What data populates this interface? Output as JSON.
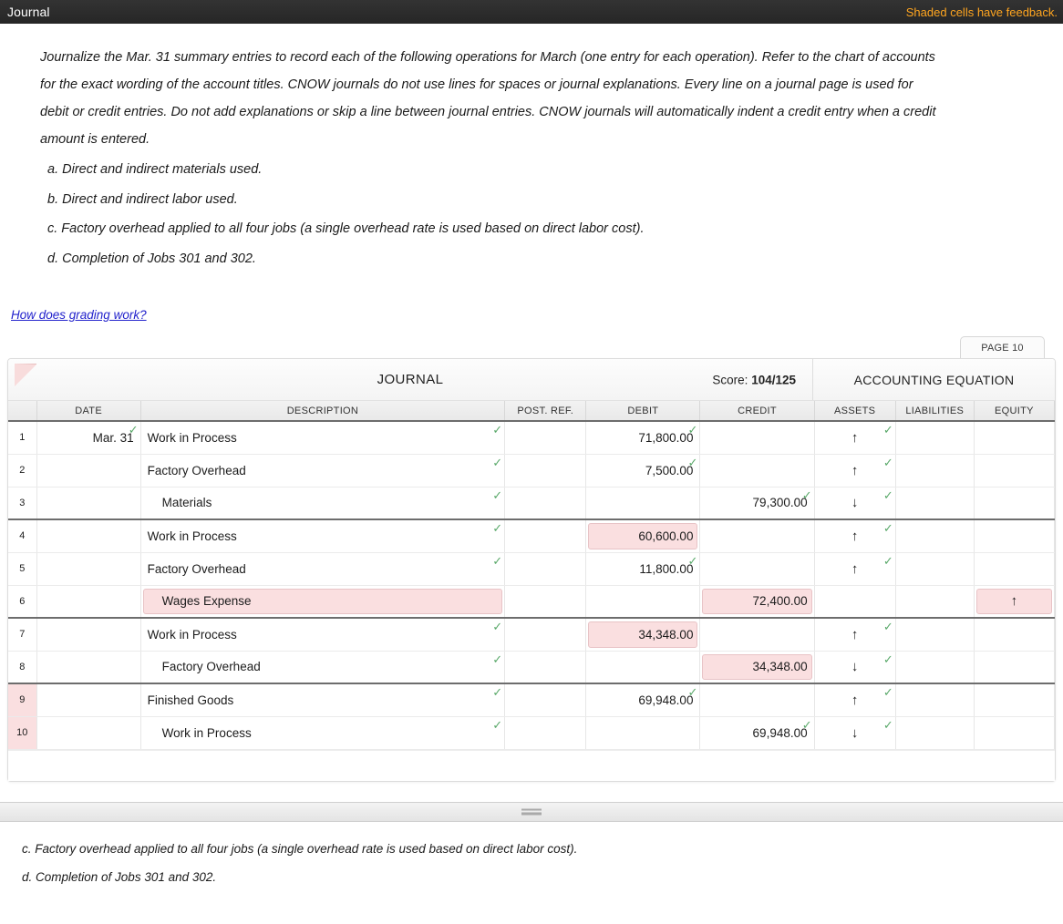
{
  "titlebar": {
    "title": "Journal",
    "feedback_note": "Shaded cells have feedback."
  },
  "instructions": {
    "paragraph": "Journalize the Mar. 31 summary entries to record each of the following operations for March (one entry for each operation). Refer to the chart of accounts for the exact wording of the account titles. CNOW journals do not use lines for spaces or journal explanations. Every line on a journal page is used for debit or credit entries. Do not add explanations or skip a line between journal entries. CNOW journals will automatically indent a credit entry when a credit amount is entered.",
    "operations": [
      "a. Direct and indirect materials used.",
      "b. Direct and indirect labor used.",
      "c. Factory overhead applied to all four jobs (a single overhead rate is used based on direct labor cost).",
      "d. Completion of Jobs 301 and 302."
    ]
  },
  "grading_link": "How does grading work?",
  "journal": {
    "page_tab": "PAGE 10",
    "title": "JOURNAL",
    "score_label": "Score:",
    "score_value": "104/125",
    "accounting_equation_title": "ACCOUNTING EQUATION",
    "columns": [
      "DATE",
      "DESCRIPTION",
      "POST. REF.",
      "DEBIT",
      "CREDIT",
      "ASSETS",
      "LIABILITIES",
      "EQUITY"
    ],
    "check_glyph": "✓",
    "arrow_up": "↑",
    "arrow_down": "↓",
    "rows": [
      {
        "num": "1",
        "num_flagged": false,
        "date": "Mar. 31",
        "date_tick": true,
        "desc": "Work in Process",
        "desc_indent": false,
        "desc_tick": true,
        "desc_shaded": false,
        "postref": "",
        "debit": "71,800.00",
        "debit_tick": true,
        "debit_shaded": false,
        "credit": "",
        "credit_tick": false,
        "credit_shaded": false,
        "assets": "↑",
        "assets_tick": true,
        "assets_shaded": false,
        "liabilities": "",
        "equity": "",
        "equity_shaded": false,
        "equity_tick": false,
        "group_end": false
      },
      {
        "num": "2",
        "num_flagged": false,
        "date": "",
        "date_tick": false,
        "desc": "Factory Overhead",
        "desc_indent": false,
        "desc_tick": true,
        "desc_shaded": false,
        "postref": "",
        "debit": "7,500.00",
        "debit_tick": true,
        "debit_shaded": false,
        "credit": "",
        "credit_tick": false,
        "credit_shaded": false,
        "assets": "↑",
        "assets_tick": true,
        "assets_shaded": false,
        "liabilities": "",
        "equity": "",
        "equity_shaded": false,
        "equity_tick": false,
        "group_end": false
      },
      {
        "num": "3",
        "num_flagged": false,
        "date": "",
        "date_tick": false,
        "desc": "Materials",
        "desc_indent": true,
        "desc_tick": true,
        "desc_shaded": false,
        "postref": "",
        "debit": "",
        "debit_tick": false,
        "debit_shaded": false,
        "credit": "79,300.00",
        "credit_tick": true,
        "credit_shaded": false,
        "assets": "↓",
        "assets_tick": true,
        "assets_shaded": false,
        "liabilities": "",
        "equity": "",
        "equity_shaded": false,
        "equity_tick": false,
        "group_end": true
      },
      {
        "num": "4",
        "num_flagged": false,
        "date": "",
        "date_tick": false,
        "desc": "Work in Process",
        "desc_indent": false,
        "desc_tick": true,
        "desc_shaded": false,
        "postref": "",
        "debit": "60,600.00",
        "debit_tick": false,
        "debit_shaded": true,
        "credit": "",
        "credit_tick": false,
        "credit_shaded": false,
        "assets": "↑",
        "assets_tick": true,
        "assets_shaded": false,
        "liabilities": "",
        "equity": "",
        "equity_shaded": false,
        "equity_tick": false,
        "group_end": false
      },
      {
        "num": "5",
        "num_flagged": false,
        "date": "",
        "date_tick": false,
        "desc": "Factory Overhead",
        "desc_indent": false,
        "desc_tick": true,
        "desc_shaded": false,
        "postref": "",
        "debit": "11,800.00",
        "debit_tick": true,
        "debit_shaded": false,
        "credit": "",
        "credit_tick": false,
        "credit_shaded": false,
        "assets": "↑",
        "assets_tick": true,
        "assets_shaded": false,
        "liabilities": "",
        "equity": "",
        "equity_shaded": false,
        "equity_tick": false,
        "group_end": false
      },
      {
        "num": "6",
        "num_flagged": false,
        "date": "",
        "date_tick": false,
        "desc": "Wages Expense",
        "desc_indent": true,
        "desc_tick": false,
        "desc_shaded": true,
        "postref": "",
        "debit": "",
        "debit_tick": false,
        "debit_shaded": false,
        "credit": "72,400.00",
        "credit_tick": false,
        "credit_shaded": true,
        "assets": "",
        "assets_tick": false,
        "assets_shaded": false,
        "liabilities": "",
        "equity": "↑",
        "equity_shaded": true,
        "equity_tick": false,
        "group_end": true
      },
      {
        "num": "7",
        "num_flagged": false,
        "date": "",
        "date_tick": false,
        "desc": "Work in Process",
        "desc_indent": false,
        "desc_tick": true,
        "desc_shaded": false,
        "postref": "",
        "debit": "34,348.00",
        "debit_tick": false,
        "debit_shaded": true,
        "credit": "",
        "credit_tick": false,
        "credit_shaded": false,
        "assets": "↑",
        "assets_tick": true,
        "assets_shaded": false,
        "liabilities": "",
        "equity": "",
        "equity_shaded": false,
        "equity_tick": false,
        "group_end": false
      },
      {
        "num": "8",
        "num_flagged": false,
        "date": "",
        "date_tick": false,
        "desc": "Factory Overhead",
        "desc_indent": true,
        "desc_tick": true,
        "desc_shaded": false,
        "postref": "",
        "debit": "",
        "debit_tick": false,
        "debit_shaded": false,
        "credit": "34,348.00",
        "credit_tick": false,
        "credit_shaded": true,
        "assets": "↓",
        "assets_tick": true,
        "assets_shaded": false,
        "liabilities": "",
        "equity": "",
        "equity_shaded": false,
        "equity_tick": false,
        "group_end": true
      },
      {
        "num": "9",
        "num_flagged": true,
        "date": "",
        "date_tick": false,
        "desc": "Finished Goods",
        "desc_indent": false,
        "desc_tick": true,
        "desc_shaded": false,
        "postref": "",
        "debit": "69,948.00",
        "debit_tick": true,
        "debit_shaded": false,
        "credit": "",
        "credit_tick": false,
        "credit_shaded": false,
        "assets": "↑",
        "assets_tick": true,
        "assets_shaded": false,
        "liabilities": "",
        "equity": "",
        "equity_shaded": false,
        "equity_tick": false,
        "group_end": false
      },
      {
        "num": "10",
        "num_flagged": true,
        "date": "",
        "date_tick": false,
        "desc": "Work in Process",
        "desc_indent": true,
        "desc_tick": true,
        "desc_shaded": false,
        "postref": "",
        "debit": "",
        "debit_tick": false,
        "debit_shaded": false,
        "credit": "69,948.00",
        "credit_tick": true,
        "credit_shaded": false,
        "assets": "↓",
        "assets_tick": true,
        "assets_shaded": false,
        "liabilities": "",
        "equity": "",
        "equity_shaded": false,
        "equity_tick": false,
        "group_end": false
      }
    ]
  },
  "bottom_pane": {
    "operations": [
      "c. Factory overhead applied to all four jobs (a single overhead rate is used based on direct labor cost).",
      "d. Completion of Jobs 301 and 302."
    ]
  },
  "colors": {
    "titlebar_bg": "#2b2b2b",
    "feedback_orange": "#ffa51f",
    "shaded_pink": "#fadfe0",
    "shaded_pink_border": "#e8c3c6",
    "check_green": "#5aa96a",
    "link_blue": "#2222cc"
  }
}
